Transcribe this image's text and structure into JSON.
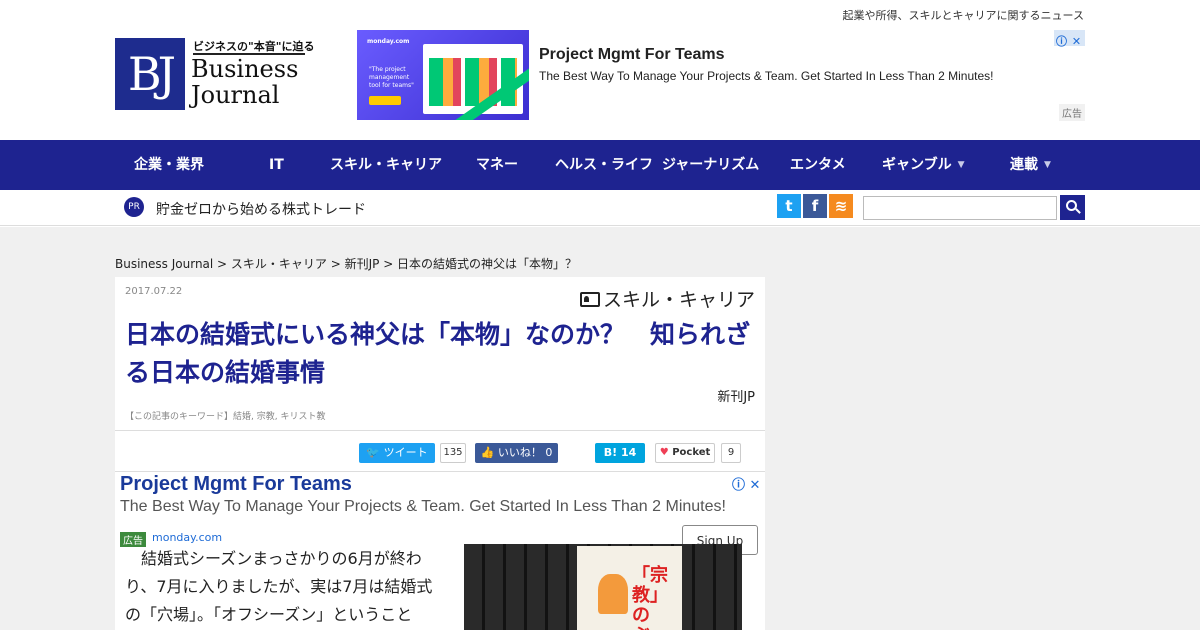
{
  "header": {
    "tagline": "起業や所得、スキルとキャリアに関するニュース",
    "logo": {
      "mark": "BJ",
      "sub": "ビジネスの\"本音\"に迫る",
      "name_line1": "Business",
      "name_line2": "Journal"
    }
  },
  "top_ad": {
    "brand": "monday.com",
    "image_text": "\"The project management tool for teams\"",
    "title": "Project Mgmt For Teams",
    "description": "The Best Way To Manage Your Projects & Team. Get Started In Less Than 2 Minutes!",
    "info_icon": "ⓘ",
    "close_icon": "✕",
    "label": "広告"
  },
  "nav": {
    "items": [
      {
        "label": "企業・業界",
        "dropdown": false
      },
      {
        "label": "IT",
        "dropdown": false
      },
      {
        "label": "スキル・キャリア",
        "dropdown": false
      },
      {
        "label": "マネー",
        "dropdown": false
      },
      {
        "label": "ヘルス・ライフ",
        "dropdown": false
      },
      {
        "label": "ジャーナリズム",
        "dropdown": false
      },
      {
        "label": "エンタメ",
        "dropdown": false
      },
      {
        "label": "ギャンブル",
        "dropdown": true
      },
      {
        "label": "連載",
        "dropdown": true
      }
    ],
    "caret": "▼"
  },
  "subbar": {
    "pr_badge": "PR",
    "pr_text": "貯金ゼロから始める株式トレード",
    "social": [
      {
        "icon": "twitter-icon",
        "glyph": "t",
        "color": "#1da1f2"
      },
      {
        "icon": "facebook-icon",
        "glyph": "f",
        "color": "#3b5998"
      },
      {
        "icon": "rss-icon",
        "glyph": "≋",
        "color": "#f58a1f"
      }
    ],
    "search_placeholder": ""
  },
  "breadcrumb": "Business Journal > スキル・キャリア > 新刊JP > 日本の結婚式の神父は「本物」？",
  "article": {
    "date": "2017.07.22",
    "category": "スキル・キャリア",
    "title": "日本の結婚式にいる神父は「本物」なのか？　知られざる日本の結婚事情",
    "author": "新刊JP",
    "keywords": "【この記事のキーワード】結婚, 宗教, キリスト教",
    "share": {
      "tweet_label": "ツイート",
      "tweet_count": "135",
      "like_label": "いいね！ 0",
      "hatena_label": "B! 14",
      "pocket_label": "Pocket",
      "pocket_count": "9"
    },
    "body_text": "　結婚式シーズンまっさかりの6月が終わり、7月に入りましたが、実は7月は結婚式の「穴場」。「オフシーズン」ということ",
    "photo_title": "「宗教」のぶっちゃけいいですか？"
  },
  "inline_ad": {
    "title": "Project Mgmt For Teams",
    "description": "The Best Way To Manage Your Projects & Team. Get Started In Less Than 2 Minutes!",
    "icons": "ⓘ ✕",
    "tag": "広告",
    "url": "monday.com",
    "button": "Sign Up"
  },
  "colors": {
    "brand_navy": "#1e2390",
    "twitter": "#1da1f2",
    "facebook": "#3b5998",
    "hatena": "#00a4de",
    "pocket": "#ef3f56"
  }
}
